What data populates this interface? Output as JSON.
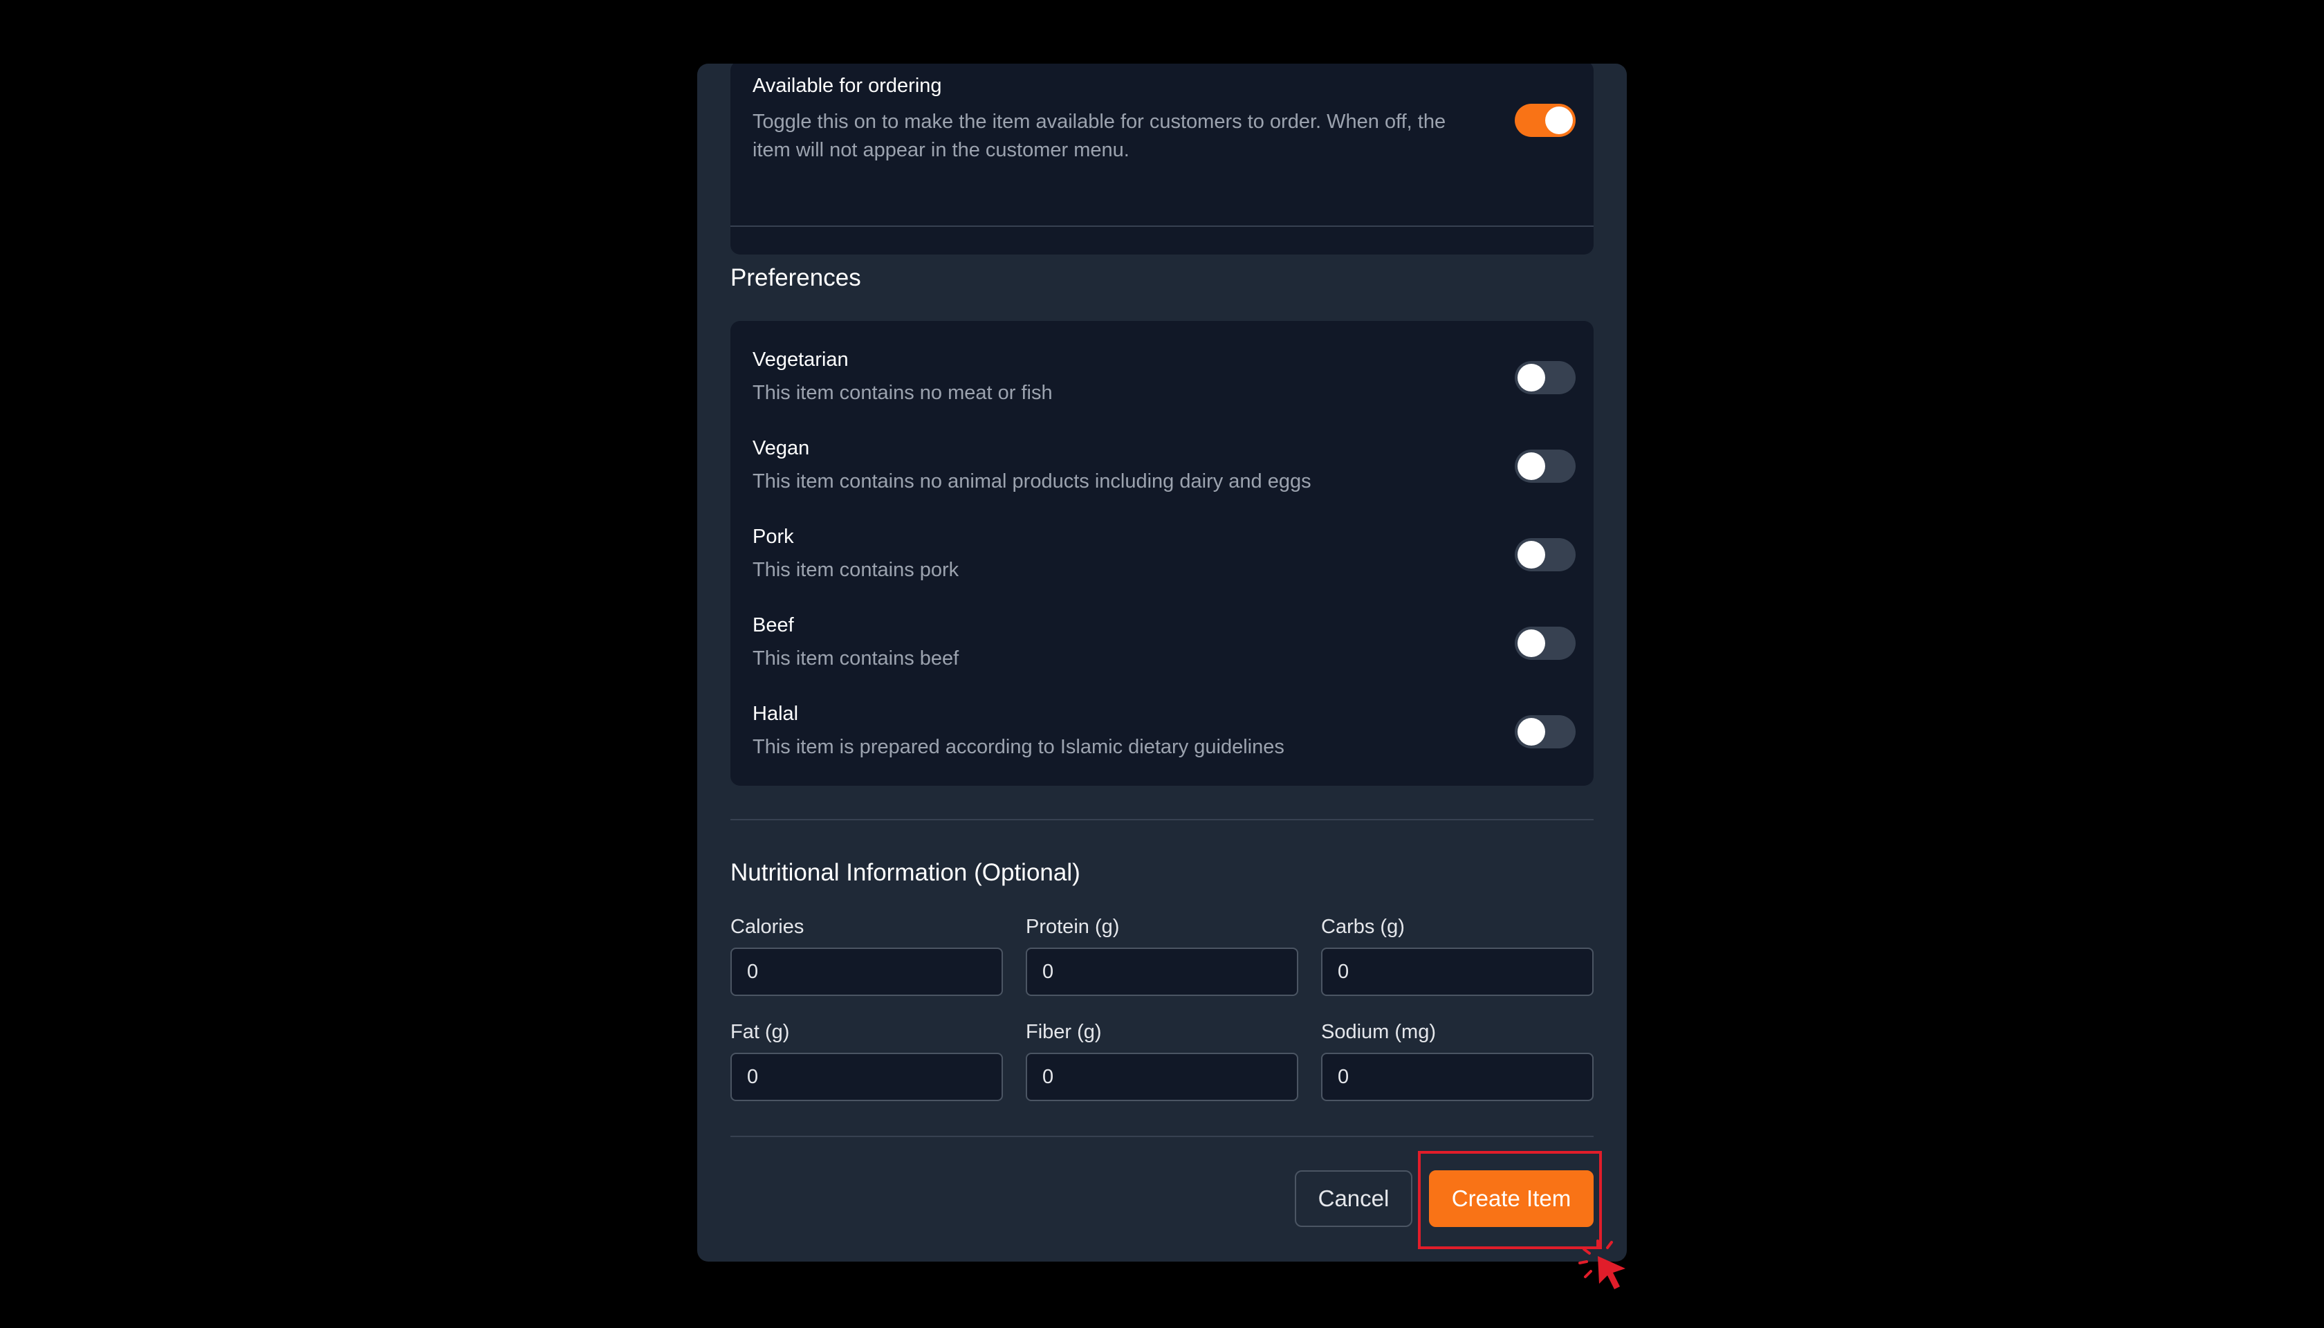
{
  "availability": {
    "title": "Available for ordering",
    "description": "Toggle this on to make the item available for customers to order. When off, the item will not appear in the customer menu.",
    "enabled": true
  },
  "preferences": {
    "title": "Preferences",
    "items": [
      {
        "label": "Vegetarian",
        "description": "This item contains no meat or fish",
        "enabled": false
      },
      {
        "label": "Vegan",
        "description": "This item contains no animal products including dairy and eggs",
        "enabled": false
      },
      {
        "label": "Pork",
        "description": "This item contains pork",
        "enabled": false
      },
      {
        "label": "Beef",
        "description": "This item contains beef",
        "enabled": false
      },
      {
        "label": "Halal",
        "description": "This item is prepared according to Islamic dietary guidelines",
        "enabled": false
      }
    ]
  },
  "nutrition": {
    "title": "Nutritional Information (Optional)",
    "fields": [
      {
        "label": "Calories",
        "value": "0"
      },
      {
        "label": "Protein (g)",
        "value": "0"
      },
      {
        "label": "Carbs (g)",
        "value": "0"
      },
      {
        "label": "Fat (g)",
        "value": "0"
      },
      {
        "label": "Fiber (g)",
        "value": "0"
      },
      {
        "label": "Sodium (mg)",
        "value": "0"
      }
    ]
  },
  "actions": {
    "cancel_label": "Cancel",
    "create_label": "Create Item"
  },
  "colors": {
    "accent": "#f97316",
    "highlight": "#e11d2a",
    "modal_bg": "#1f2937",
    "card_bg": "#111827"
  }
}
